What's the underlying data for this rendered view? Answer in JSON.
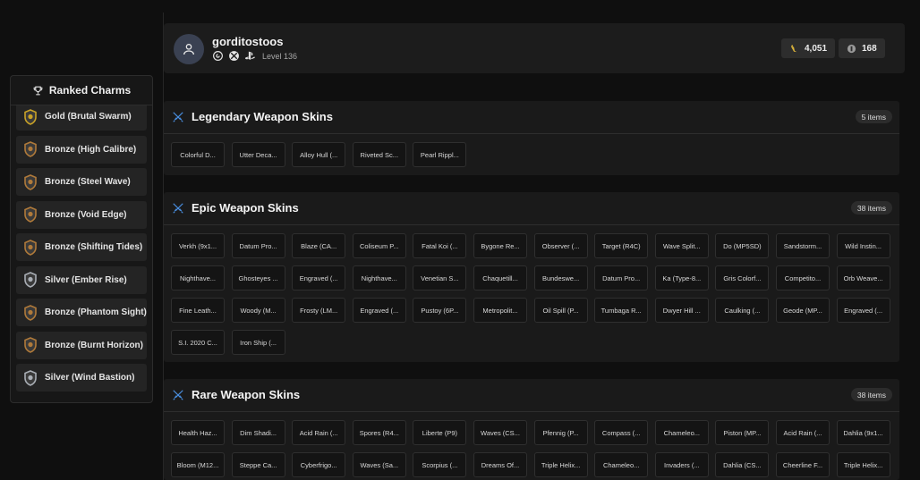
{
  "sidebar": {
    "title": "Ranked Charms",
    "items": [
      {
        "label": "Gold (Brutal Swarm)",
        "tier": "gold"
      },
      {
        "label": "Bronze (High Calibre)",
        "tier": "bronze"
      },
      {
        "label": "Bronze (Steel Wave)",
        "tier": "bronze"
      },
      {
        "label": "Bronze (Void Edge)",
        "tier": "bronze"
      },
      {
        "label": "Bronze (Shifting Tides)",
        "tier": "bronze"
      },
      {
        "label": "Silver (Ember Rise)",
        "tier": "silver"
      },
      {
        "label": "Bronze (Phantom Sight)",
        "tier": "bronze"
      },
      {
        "label": "Bronze (Burnt Horizon)",
        "tier": "bronze"
      },
      {
        "label": "Silver (Wind Bastion)",
        "tier": "silver"
      }
    ]
  },
  "profile": {
    "username": "gorditostoos",
    "level": "Level 136",
    "platforms": [
      "ubisoft-icon",
      "xbox-icon",
      "playstation-icon"
    ],
    "renown": "4,051",
    "credits": "168"
  },
  "sections": [
    {
      "title": "Legendary Weapon Skins",
      "count": "5 items",
      "items": [
        "Colorful D...",
        "Utter Deca...",
        "Alloy Hull (...",
        "Riveted Sc...",
        "Pearl Rippl..."
      ]
    },
    {
      "title": "Epic Weapon Skins",
      "count": "38 items",
      "items": [
        "Verkh (9x1...",
        "Datum Pro...",
        "Blaze (CA...",
        "Coliseum P...",
        "Fatal Koi (...",
        "Bygone Re...",
        "Observer (...",
        "Target (R4C)",
        "Wave Split...",
        "Do (MP5SD)",
        "Sandstorm...",
        "Wild Instin...",
        "Nighthave...",
        "Ghosteyes ...",
        "Engraved (...",
        "Nighthave...",
        "Venetian S...",
        "Chaquetill...",
        "Bundeswe...",
        "Datum Pro...",
        "Ka (Type-8...",
        "Gris Colorf...",
        "Competito...",
        "Orb Weave...",
        "Fine Leath...",
        "Woody (M...",
        "Frosty (LM...",
        "Engraved (...",
        "Pustoy (6P...",
        "Metropolit...",
        "Oil Spill (P...",
        "Tumbaga R...",
        "Dwyer Hill ...",
        "Caulking (...",
        "Geode (MP...",
        "Engraved (...",
        "S.I. 2020 C...",
        "Iron Ship (..."
      ]
    },
    {
      "title": "Rare Weapon Skins",
      "count": "38 items",
      "items": [
        "Health Haz...",
        "Dim Shadi...",
        "Acid Rain (...",
        "Spores (R4...",
        "Liberte (P9)",
        "Waves (CS...",
        "Pfennig (P...",
        "Compass (...",
        "Chameleo...",
        "Piston (MP...",
        "Acid Rain (...",
        "Dahlia (9x1...",
        "Bloom (M12...",
        "Steppe Ca...",
        "Cyberfrigo...",
        "Waves (Sa...",
        "Scorpius (...",
        "Dreams Of...",
        "Triple Helix...",
        "Chameleo...",
        "Invaders (...",
        "Dahlia (CS...",
        "Cheerline F...",
        "Triple Helix..."
      ]
    }
  ],
  "colors": {
    "background": "#0f0f0f",
    "panel": "#1a1a1a",
    "chip": "#141414",
    "accent_icon": "#4a90e2",
    "gold": "#c9a227",
    "bronze": "#b07a3a",
    "silver": "#a9aeb5"
  }
}
